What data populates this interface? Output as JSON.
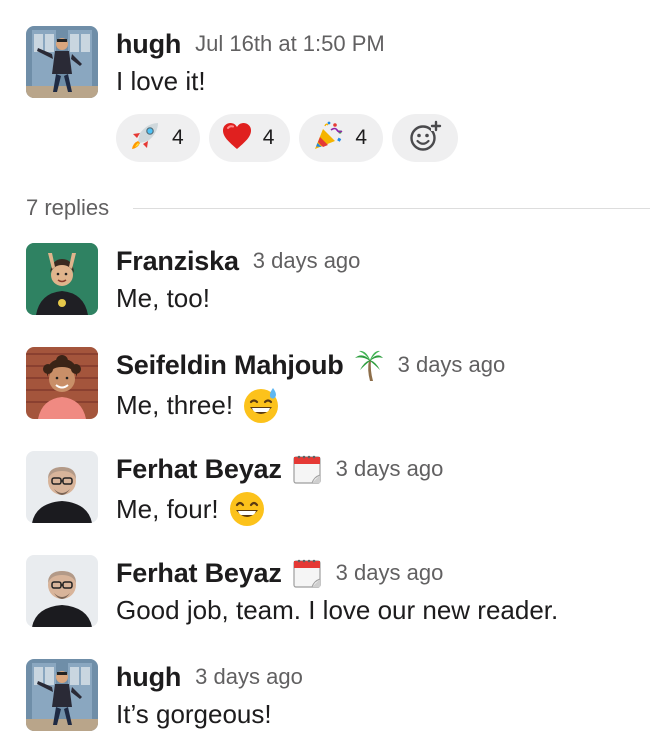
{
  "thread": {
    "parent": {
      "author": "hugh",
      "timestamp": "Jul 16th at 1:50 PM",
      "text": "I love it!",
      "reactions": [
        {
          "emoji": "rocket",
          "count": "4"
        },
        {
          "emoji": "red-heart",
          "count": "4"
        },
        {
          "emoji": "party-popper",
          "count": "4"
        }
      ]
    },
    "replies_label": "7 replies",
    "replies": [
      {
        "author": "Franziska",
        "timestamp": "3 days ago",
        "text": "Me, too!"
      },
      {
        "author": "Seifeldin Mahjoub",
        "status_emoji": "palm-tree",
        "timestamp": "3 days ago",
        "text": "Me, three!",
        "emoji": "grinning-sweat"
      },
      {
        "author": "Ferhat Beyaz",
        "status_emoji": "calendar",
        "timestamp": "3 days ago",
        "text": "Me, four!",
        "emoji": "grinning-smile"
      },
      {
        "author": "Ferhat Beyaz",
        "status_emoji": "calendar",
        "timestamp": "3 days ago",
        "text": "Good job, team. I love our new reader."
      },
      {
        "author": "hugh",
        "timestamp": "3 days ago",
        "text": "It’s gorgeous!"
      }
    ]
  },
  "colors": {
    "text": "#1d1c1d",
    "muted": "#616061",
    "pill_bg": "#efeff0",
    "divider": "#dddddd"
  }
}
